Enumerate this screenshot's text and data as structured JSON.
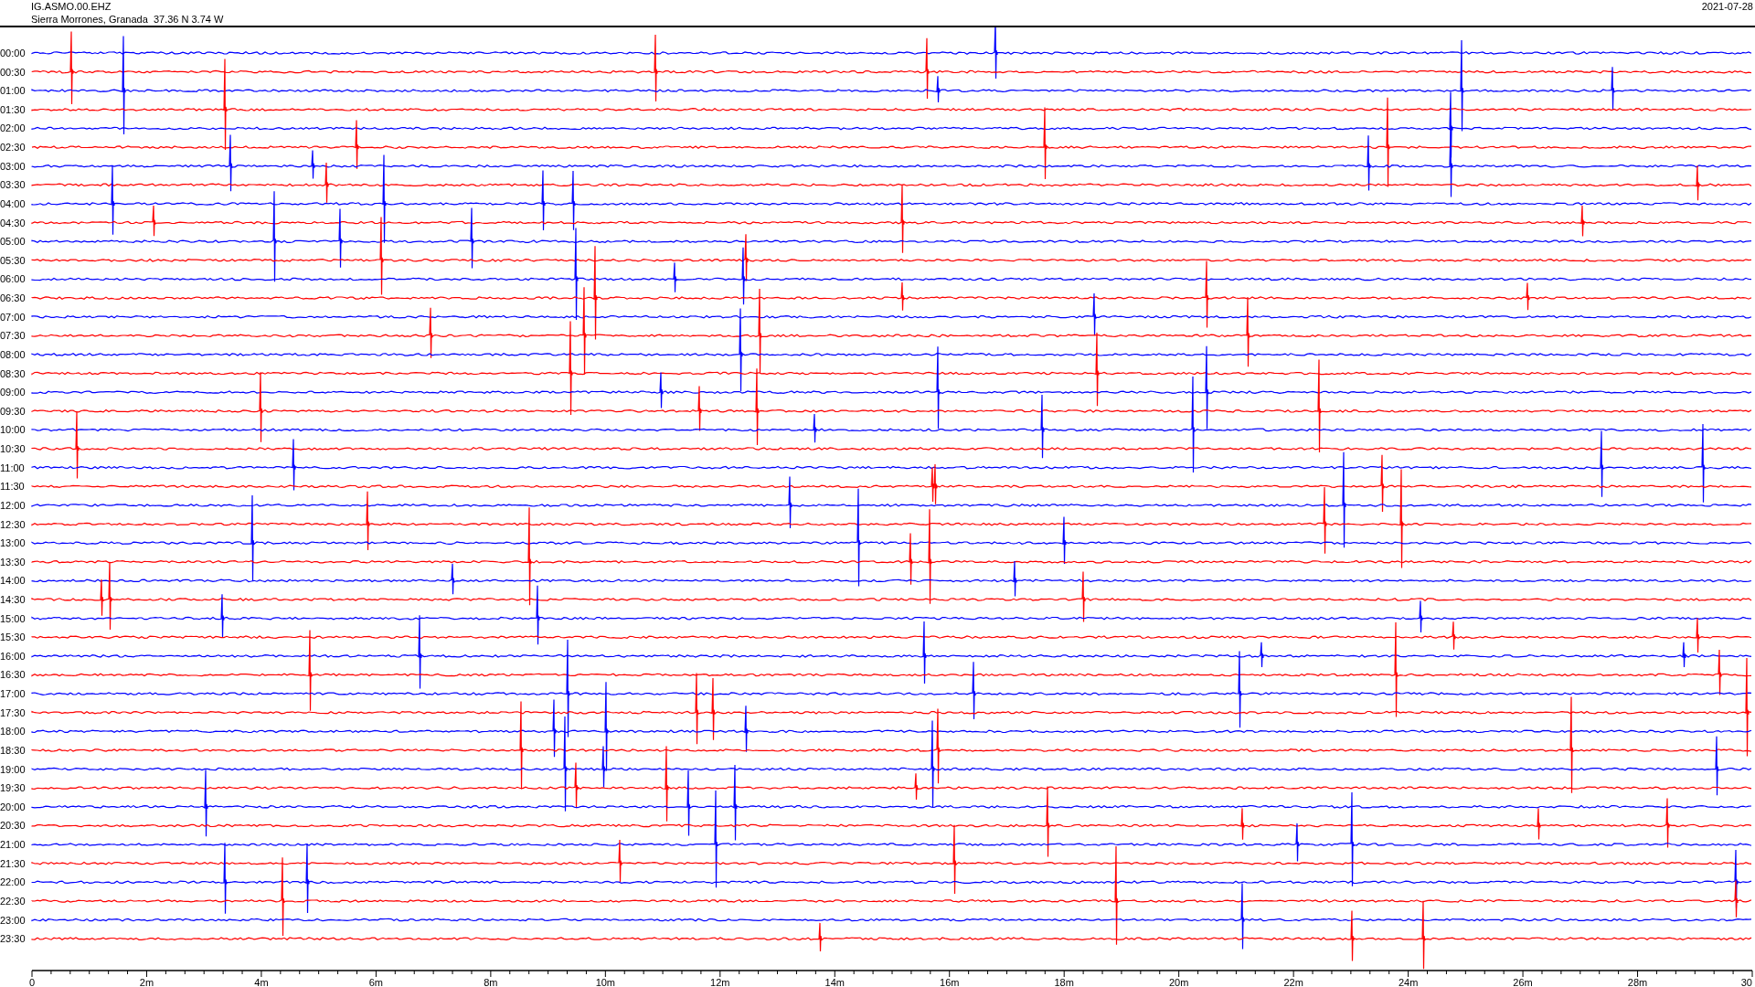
{
  "header": {
    "station": "IG.ASMO.00.EHZ",
    "location": "Sierra Morrones, Granada  37.36 N 3.74 W",
    "date": "2021-07-28"
  },
  "rows": [
    {
      "label": "00:00",
      "color": "#0000ff"
    },
    {
      "label": "00:30",
      "color": "#ff0000"
    },
    {
      "label": "01:00",
      "color": "#0000ff"
    },
    {
      "label": "01:30",
      "color": "#ff0000"
    },
    {
      "label": "02:00",
      "color": "#0000ff"
    },
    {
      "label": "02:30",
      "color": "#ff0000"
    },
    {
      "label": "03:00",
      "color": "#0000ff"
    },
    {
      "label": "03:30",
      "color": "#ff0000"
    },
    {
      "label": "04:00",
      "color": "#0000ff"
    },
    {
      "label": "04:30",
      "color": "#ff0000"
    },
    {
      "label": "05:00",
      "color": "#0000ff"
    },
    {
      "label": "05:30",
      "color": "#ff0000"
    },
    {
      "label": "06:00",
      "color": "#0000ff"
    },
    {
      "label": "06:30",
      "color": "#ff0000"
    },
    {
      "label": "07:00",
      "color": "#0000ff"
    },
    {
      "label": "07:30",
      "color": "#ff0000"
    },
    {
      "label": "08:00",
      "color": "#0000ff"
    },
    {
      "label": "08:30",
      "color": "#ff0000"
    },
    {
      "label": "09:00",
      "color": "#0000ff"
    },
    {
      "label": "09:30",
      "color": "#ff0000"
    },
    {
      "label": "10:00",
      "color": "#0000ff"
    },
    {
      "label": "10:30",
      "color": "#ff0000"
    },
    {
      "label": "11:00",
      "color": "#0000ff"
    },
    {
      "label": "11:30",
      "color": "#ff0000"
    },
    {
      "label": "12:00",
      "color": "#0000ff"
    },
    {
      "label": "12:30",
      "color": "#ff0000"
    },
    {
      "label": "13:00",
      "color": "#0000ff"
    },
    {
      "label": "13:30",
      "color": "#ff0000"
    },
    {
      "label": "14:00",
      "color": "#0000ff"
    },
    {
      "label": "14:30",
      "color": "#ff0000"
    },
    {
      "label": "15:00",
      "color": "#0000ff"
    },
    {
      "label": "15:30",
      "color": "#ff0000"
    },
    {
      "label": "16:00",
      "color": "#0000ff"
    },
    {
      "label": "16:30",
      "color": "#ff0000"
    },
    {
      "label": "17:00",
      "color": "#0000ff"
    },
    {
      "label": "17:30",
      "color": "#ff0000"
    },
    {
      "label": "18:00",
      "color": "#0000ff"
    },
    {
      "label": "18:30",
      "color": "#ff0000"
    },
    {
      "label": "19:00",
      "color": "#0000ff"
    },
    {
      "label": "19:30",
      "color": "#ff0000"
    },
    {
      "label": "20:00",
      "color": "#0000ff"
    },
    {
      "label": "20:30",
      "color": "#ff0000"
    },
    {
      "label": "21:00",
      "color": "#0000ff"
    },
    {
      "label": "21:30",
      "color": "#ff0000"
    },
    {
      "label": "22:00",
      "color": "#0000ff"
    },
    {
      "label": "22:30",
      "color": "#ff0000"
    },
    {
      "label": "23:00",
      "color": "#0000ff"
    },
    {
      "label": "23:30",
      "color": "#ff0000"
    }
  ],
  "x_axis": {
    "labels": [
      "0",
      "2m",
      "4m",
      "6m",
      "8m",
      "10m",
      "12m",
      "14m",
      "16m",
      "18m",
      "20m",
      "22m",
      "24m",
      "26m",
      "28m",
      "30"
    ]
  }
}
